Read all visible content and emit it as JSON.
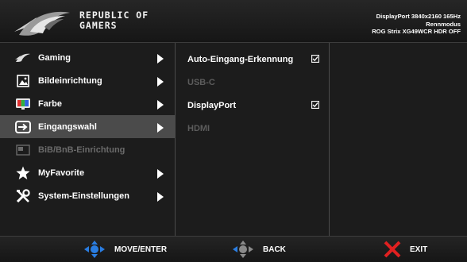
{
  "header": {
    "brand_line1": "REPUBLIC OF",
    "brand_line2": "GAMERS",
    "status_line1": "DisplayPort 3840x2160 165Hz",
    "status_line2": "Rennmodus",
    "status_line3": "ROG Strix XG49WCR HDR OFF"
  },
  "main_menu": [
    {
      "label": "Gaming",
      "icon": "rog-eye-icon"
    },
    {
      "label": "Bildeinrichtung",
      "icon": "image-icon"
    },
    {
      "label": "Farbe",
      "icon": "color-icon"
    },
    {
      "label": "Eingangswahl",
      "icon": "input-icon",
      "selected": true
    },
    {
      "label": "BiB/BnB-Einrichtung",
      "icon": "pip-icon",
      "disabled": true
    },
    {
      "label": "MyFavorite",
      "icon": "star-icon"
    },
    {
      "label": "System-Einstellungen",
      "icon": "tools-icon"
    }
  ],
  "sub_menu": [
    {
      "label": "Auto-Eingang-Erkennung",
      "checked": true
    },
    {
      "label": "USB-C",
      "disabled": true
    },
    {
      "label": "DisplayPort",
      "checked": true
    },
    {
      "label": "HDMI",
      "disabled": true
    }
  ],
  "footer": {
    "move_label": "MOVE/ENTER",
    "back_label": "BACK",
    "exit_label": "EXIT"
  },
  "colors": {
    "accent_blue": "#2a7de1",
    "exit_red": "#e02020",
    "selected_bg": "#4b4b4b"
  }
}
